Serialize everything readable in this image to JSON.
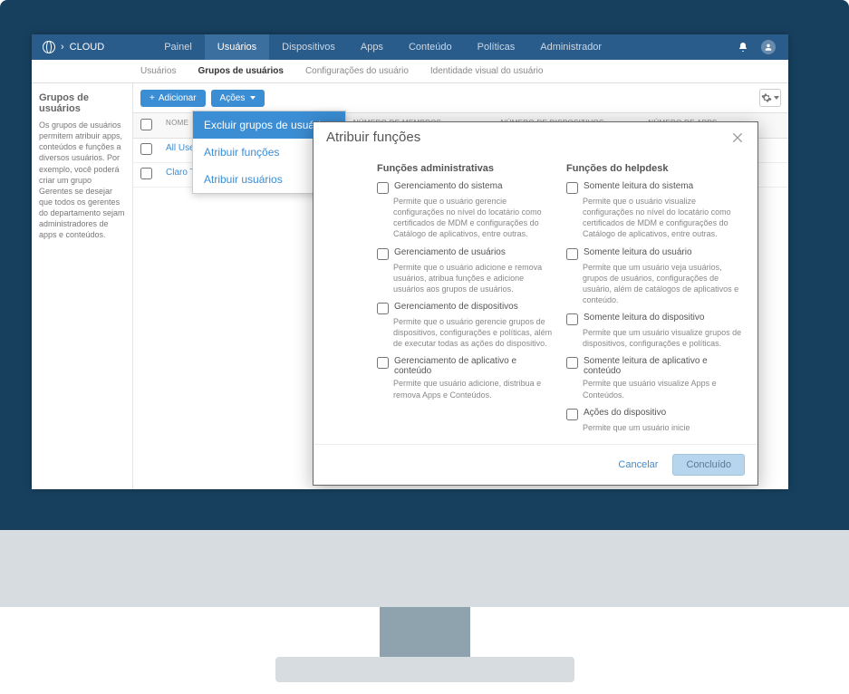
{
  "brand": {
    "caret": "›",
    "name": "CLOUD"
  },
  "nav": {
    "items": [
      {
        "label": "Painel"
      },
      {
        "label": "Usuários",
        "active": true
      },
      {
        "label": "Dispositivos"
      },
      {
        "label": "Apps"
      },
      {
        "label": "Conteúdo"
      },
      {
        "label": "Políticas"
      },
      {
        "label": "Administrador"
      }
    ]
  },
  "subnav": {
    "items": [
      {
        "label": "Usuários"
      },
      {
        "label": "Grupos de usuários",
        "active": true
      },
      {
        "label": "Configurações do usuário"
      },
      {
        "label": "Identidade visual do usuário"
      }
    ]
  },
  "sidebar": {
    "title": "Grupos de usuários",
    "desc": "Os grupos de usuários permitem atribuir apps, conteúdos e funções a diversos usuários. Por exemplo, você poderá criar um grupo Gerentes se desejar que todos os gerentes do departamento sejam administradores de apps e conteúdos."
  },
  "toolbar": {
    "add_label": "Adicionar",
    "add_plus": "+",
    "actions_label": "Ações"
  },
  "dropdown": {
    "items": [
      {
        "label": "Excluir grupos de usuários",
        "active": true
      },
      {
        "label": "Atribuir funções"
      },
      {
        "label": "Atribuir usuários"
      }
    ]
  },
  "table": {
    "headers": {
      "name": "NOME",
      "members": "NÚMERO DE MEMBROS",
      "devices": "NÚMERO DE DISPOSITIVOS",
      "apps": "NÚMERO DE APPS"
    },
    "rows": [
      {
        "name": "All Users"
      },
      {
        "name": "Claro TotalSh"
      }
    ]
  },
  "modal": {
    "title": "Atribuir funções",
    "col_admin_title": "Funções administrativas",
    "col_help_title": "Funções do helpdesk",
    "admin_roles": [
      {
        "title": "Gerenciamento do sistema",
        "desc": "Permite que o usuário gerencie configurações no nível do locatário como certificados de MDM e configurações do Catálogo de aplicativos, entre outras."
      },
      {
        "title": "Gerenciamento de usuários",
        "desc": "Permite que o usuário adicione e remova usuários, atribua funções e adicione usuários aos grupos de usuários."
      },
      {
        "title": "Gerenciamento de dispositivos",
        "desc": "Permite que o usuário gerencie grupos de dispositivos, configurações e políticas, além de executar todas as ações do dispositivo."
      },
      {
        "title": "Gerenciamento de aplicativo e conteúdo",
        "desc": "Permite que usuário adicione, distribua e remova Apps e Conteúdos."
      }
    ],
    "help_roles": [
      {
        "title": "Somente leitura do sistema",
        "desc": "Permite que o usuário visualize configurações no nível do locatário como certificados de MDM e configurações do Catálogo de aplicativos, entre outras."
      },
      {
        "title": "Somente leitura do usuário",
        "desc": "Permite que um usuário veja usuários, grupos de usuários, configurações de usuário, além de catálogos de aplicativos e conteúdo."
      },
      {
        "title": "Somente leitura do dispositivo",
        "desc": "Permite que um usuário visualize grupos de dispositivos, configurações e políticas."
      },
      {
        "title": "Somente leitura de aplicativo e conteúdo",
        "desc": "Permite que usuário visualize Apps e Conteúdos."
      },
      {
        "title": "Ações do dispositivo",
        "desc": "Permite que um usuário inicie"
      }
    ],
    "cancel_label": "Cancelar",
    "done_label": "Concluído"
  }
}
